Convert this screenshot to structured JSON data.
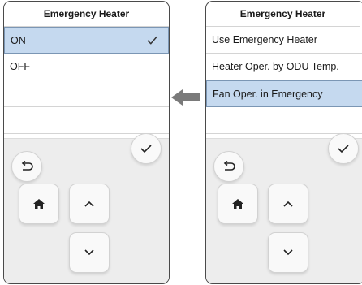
{
  "left_screen": {
    "title": "Emergency Heater",
    "items": [
      {
        "label": "ON",
        "selected": true,
        "checked": true
      },
      {
        "label": "OFF",
        "selected": false,
        "checked": false
      },
      {
        "label": "",
        "selected": false,
        "checked": false
      },
      {
        "label": "",
        "selected": false,
        "checked": false
      }
    ]
  },
  "right_screen": {
    "title": "Emergency Heater",
    "items": [
      {
        "label": "Use Emergency Heater",
        "selected": false
      },
      {
        "label": "Heater Oper. by ODU Temp.",
        "selected": false
      },
      {
        "label": "Fan Oper. in Emergency",
        "selected": true
      },
      {
        "label": "",
        "selected": false
      }
    ]
  },
  "controls": [
    "back-icon",
    "confirm-check-icon",
    "home-icon",
    "up-arrow-icon",
    "down-arrow-icon"
  ],
  "transition_arrow": {
    "direction": "left",
    "color": "#7a7a7a"
  },
  "colors": {
    "selection_bg": "#c5d9ef",
    "selection_border": "#7b96b4",
    "panel_bg": "#ededed"
  }
}
